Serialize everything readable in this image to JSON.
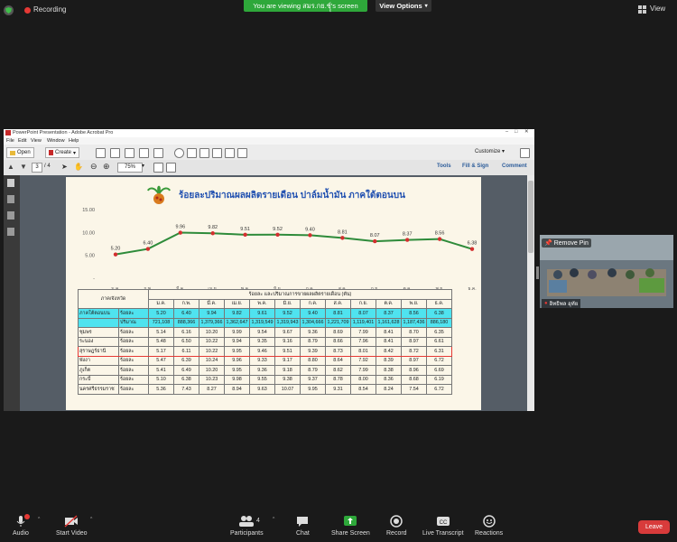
{
  "topbar": {
    "recording_label": "Recording",
    "viewing_label": "You are viewing สมร.กย.ชุ์ุ's screen",
    "view_options_label": "View Options",
    "view_label": "View"
  },
  "acrobat": {
    "title": "PowerPoint Presentation - Adobe Acrobat Pro",
    "menu": [
      "File",
      "Edit",
      "View",
      "Window",
      "Help"
    ],
    "open_label": "Open",
    "create_label": "Create",
    "customize_label": "Customize",
    "page_current": "3",
    "page_total": "/ 4",
    "zoom": "75%",
    "tools_label": "Tools",
    "fillsign_label": "Fill & Sign",
    "comment_label": "Comment"
  },
  "slide": {
    "title": "ร้อยละปริมาณผลผลิตรายเดือน ปาล์มน้ำมัน ภาคใต้ตอนบน",
    "table_header_region": "ภาค/จังหวัด",
    "table_header_group": "ร้อยละ และปริมาณการขายผลผลิตรายเดือน (ตัน)",
    "months": [
      "ม.ค.",
      "ก.พ.",
      "มี.ค.",
      "เม.ย.",
      "พ.ค.",
      "มิ.ย.",
      "ก.ค.",
      "ส.ค.",
      "ก.ย.",
      "ต.ค.",
      "พ.ย.",
      "ธ.ค."
    ],
    "rows": [
      {
        "prov": "ภาคใต้ตอนบน",
        "unit": "ร้อยละ",
        "vals": [
          "5.20",
          "6.40",
          "9.94",
          "9.82",
          "9.61",
          "9.52",
          "9.40",
          "8.81",
          "8.07",
          "8.37",
          "8.56",
          "6.38"
        ],
        "cyan": true
      },
      {
        "prov": "",
        "unit": "ปริมาณ",
        "vals": [
          "721,108",
          "888,366",
          "1,379,366",
          "1,362,647",
          "1,319,549",
          "1,319,943",
          "1,304,666",
          "1,221,709",
          "1,119,401",
          "1,161,628",
          "1,187,436",
          "886,180"
        ],
        "cyan": true
      },
      {
        "prov": "ชุมพร",
        "unit": "ร้อยละ",
        "vals": [
          "5.14",
          "6.16",
          "10.20",
          "9.99",
          "9.54",
          "9.67",
          "9.36",
          "8.69",
          "7.99",
          "8.41",
          "8.70",
          "6.35"
        ]
      },
      {
        "prov": "ระนอง",
        "unit": "ร้อยละ",
        "vals": [
          "5.48",
          "6.50",
          "10.22",
          "9.94",
          "9.35",
          "9.16",
          "8.79",
          "8.66",
          "7.96",
          "8.41",
          "8.97",
          "6.61"
        ]
      },
      {
        "prov": "สุราษฎร์ธานี",
        "unit": "ร้อยละ",
        "vals": [
          "5.17",
          "6.11",
          "10.22",
          "9.95",
          "9.46",
          "9.51",
          "9.39",
          "8.73",
          "8.01",
          "8.42",
          "8.72",
          "6.31"
        ],
        "highlight": true
      },
      {
        "prov": "พังงา",
        "unit": "ร้อยละ",
        "vals": [
          "5.47",
          "6.39",
          "10.24",
          "9.96",
          "9.33",
          "9.17",
          "8.80",
          "8.64",
          "7.92",
          "8.39",
          "8.97",
          "6.72"
        ]
      },
      {
        "prov": "ภูเก็ต",
        "unit": "ร้อยละ",
        "vals": [
          "5.41",
          "6.49",
          "10.20",
          "9.95",
          "9.36",
          "9.18",
          "8.79",
          "8.62",
          "7.99",
          "8.38",
          "8.96",
          "6.69"
        ]
      },
      {
        "prov": "กระบี่",
        "unit": "ร้อยละ",
        "vals": [
          "5.10",
          "6.38",
          "10.23",
          "9.98",
          "9.55",
          "9.38",
          "9.37",
          "8.78",
          "8.00",
          "8.36",
          "8.68",
          "6.19"
        ]
      },
      {
        "prov": "นครศรีธรรมราช",
        "unit": "ร้อยละ",
        "vals": [
          "5.36",
          "7.43",
          "8.27",
          "8.94",
          "9.63",
          "10.07",
          "9.95",
          "9.31",
          "8.54",
          "8.24",
          "7.54",
          "6.72"
        ]
      }
    ]
  },
  "chart_data": {
    "type": "line",
    "categories": [
      "ม.ค.",
      "ก.พ.",
      "มี.ค.",
      "เม.ย.",
      "พ.ค.",
      "มิ.ย.",
      "ก.ค.",
      "ส.ค.",
      "ก.ย.",
      "ต.ค.",
      "พ.ย.",
      "ธ.ค."
    ],
    "values": [
      5.2,
      6.4,
      9.96,
      9.82,
      9.51,
      9.52,
      9.4,
      8.81,
      8.07,
      8.37,
      8.56,
      6.38
    ],
    "value_labels": [
      "5.20",
      "6.40",
      "9.96",
      "9.82",
      "9.51",
      "9.52",
      "9.40",
      "8.81",
      "8.07",
      "8.37",
      "8.56",
      "6.38"
    ],
    "y_ticks": [
      "15.00",
      "10.00",
      "5.00",
      "-"
    ],
    "ylim": [
      0,
      15
    ],
    "line_color": "#2e8b3a",
    "marker_color": "#d32f2f",
    "grid": false
  },
  "video": {
    "remove_pin_label": "Remove Pin",
    "participant_name": "อิทธิพล อุทัย"
  },
  "bottombar": {
    "audio_label": "Audio",
    "start_video_label": "Start Video",
    "participants_label": "Participants",
    "participants_count": "4",
    "chat_label": "Chat",
    "share_label": "Share Screen",
    "record_label": "Record",
    "transcript_label": "Live Transcript",
    "reactions_label": "Reactions",
    "leave_label": "Leave",
    "accent_green": "#2ea83a",
    "leave_color": "#d83b3b"
  }
}
